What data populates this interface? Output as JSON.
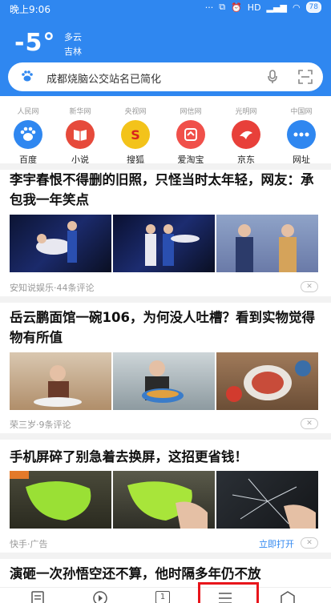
{
  "status": {
    "time": "晚上9:06",
    "battery": "78",
    "icons": [
      "signal-icon",
      "wifi-icon",
      "alarm-icon",
      "hd-icon"
    ]
  },
  "weather": {
    "temp": "-5°",
    "condition": "多云",
    "city": "吉林"
  },
  "search": {
    "text": "成都烧脑公交站名已简化"
  },
  "shortcuts": [
    {
      "src": "人民网",
      "label": "百度",
      "color": "#2f87f0",
      "icon": "baidu-paw-icon"
    },
    {
      "src": "新华网",
      "label": "小说",
      "color": "#e64a3b",
      "icon": "book-icon"
    },
    {
      "src": "央视网",
      "label": "搜狐",
      "color": "#f3c31a",
      "icon": "sohu-icon"
    },
    {
      "src": "网信网",
      "label": "爱淘宝",
      "color": "#f0504a",
      "icon": "taobao-icon"
    },
    {
      "src": "光明网",
      "label": "京东",
      "color": "#e8403a",
      "icon": "jd-icon"
    },
    {
      "src": "中国网",
      "label": "网址",
      "color": "#2f87f0",
      "icon": "more-dots-icon"
    }
  ],
  "articles": [
    {
      "title": "李宇春恨不得删的旧照，只怪当时太年轻，网友：承包我一年笑点",
      "meta": "安知说娱乐·44条评论"
    },
    {
      "title": "岳云鹏面馆一碗106，为何没人吐槽？看到实物觉得物有所值",
      "meta": "荣三岁·9条评论"
    },
    {
      "title": "手机屏碎了别急着去换屏，这招更省钱！",
      "meta": "快手·广告",
      "action": "立即打开"
    },
    {
      "title": "演砸一次孙悟空还不算，他时隔多年仍不放"
    }
  ],
  "bottom_nav": {
    "tab_count": "1",
    "icons": [
      "news-icon",
      "video-icon",
      "tabs-icon",
      "menu-icon",
      "home-icon"
    ]
  },
  "colors": {
    "brand": "#2f87f0",
    "highlight": "#e8151b"
  }
}
